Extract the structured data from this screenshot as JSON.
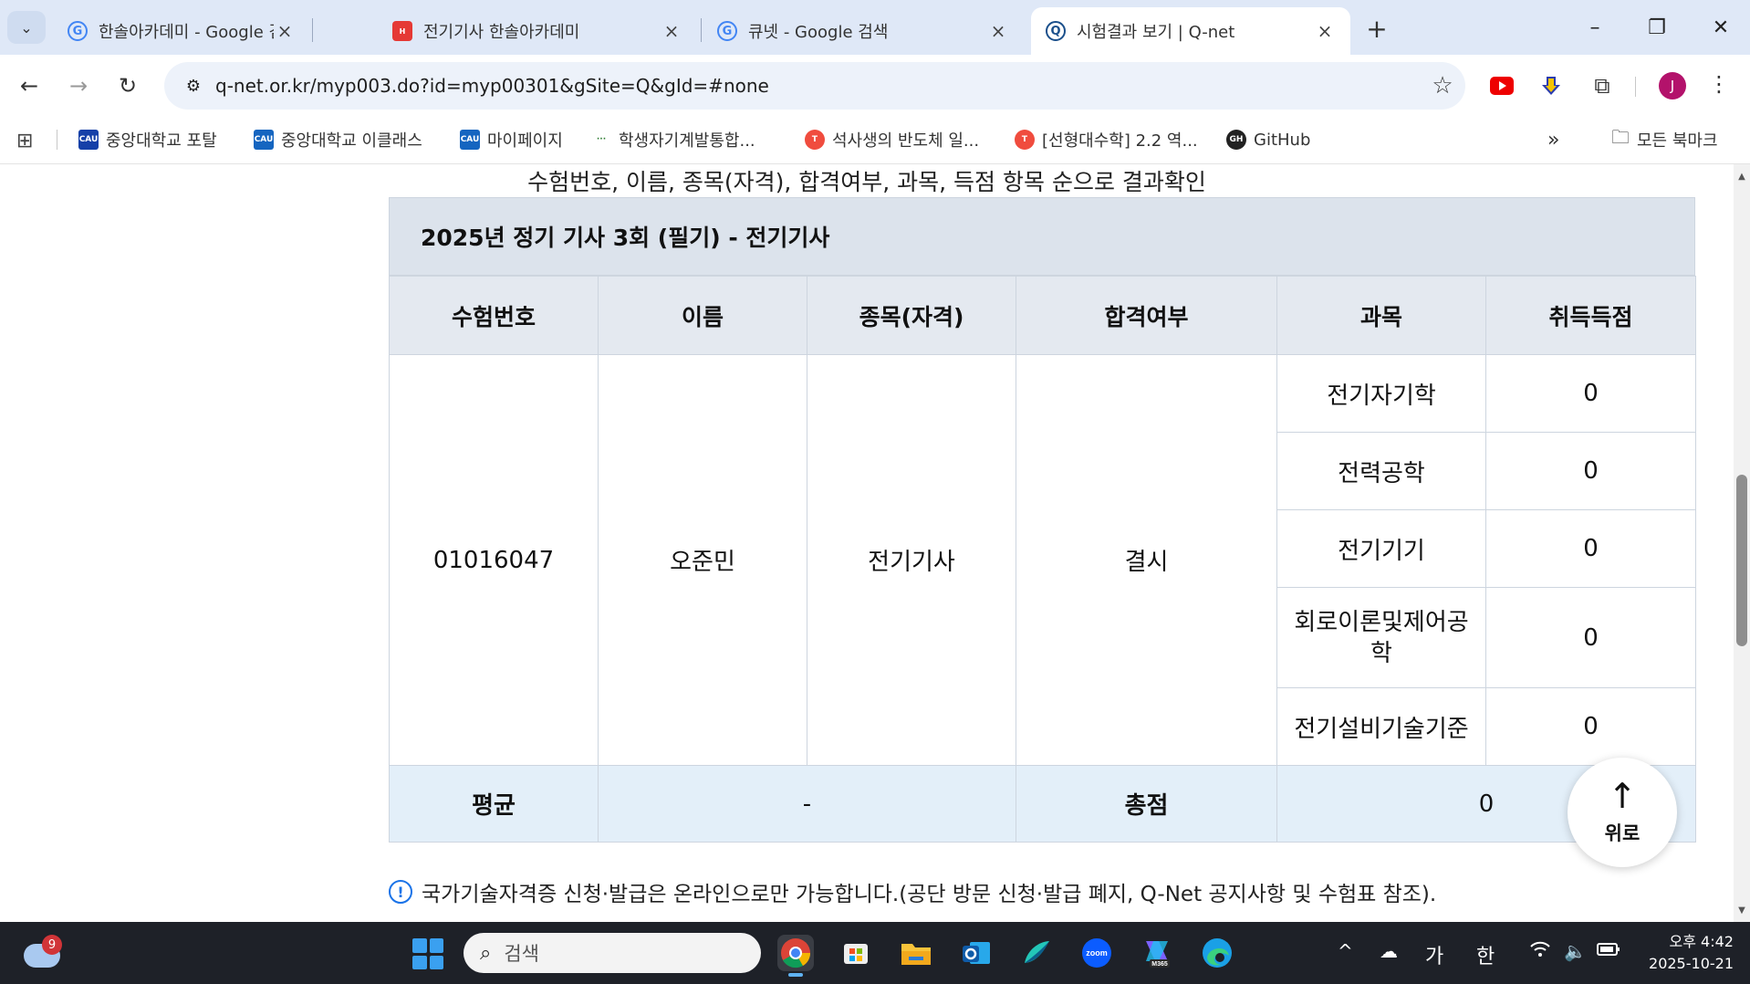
{
  "tabs": [
    {
      "title": "한솔아카데미 - Google 검색",
      "favicon": "google-icon"
    },
    {
      "title": "전기기사 한솔아카데미",
      "favicon": "hansol-icon"
    },
    {
      "title": "큐넷 - Google 검색",
      "favicon": "google-icon"
    },
    {
      "title": "시험결과 보기 | Q-net",
      "favicon": "qnet-icon",
      "active": true
    }
  ],
  "address_bar": {
    "url": "q-net.or.kr/myp003.do?id=myp00301&gSite=Q&gId=#none"
  },
  "profile_initial": "J",
  "bookmarks": [
    {
      "label": "중앙대학교 포탈",
      "icon_text": "CAU"
    },
    {
      "label": "중앙대학교 이클래스",
      "icon_text": "CAU"
    },
    {
      "label": "마이페이지",
      "icon_text": "CAU"
    },
    {
      "label": "학생자기계발통합...",
      "icon_text": "···"
    },
    {
      "label": "석사생의 반도체 일...",
      "icon_text": "T"
    },
    {
      "label": "[선형대수학] 2.2 역...",
      "icon_text": "T"
    },
    {
      "label": "GitHub",
      "icon_text": "GH"
    }
  ],
  "bookmarks_overflow": "»",
  "all_bookmarks": "모든 북마크",
  "page": {
    "heading": "수험번호, 이름, 종목(자격), 합격여부, 과목, 득점 항목 순으로 결과확인",
    "box_title": "2025년 정기 기사 3회 (필기) - 전기기사",
    "columns": [
      "수험번호",
      "이름",
      "종목(자격)",
      "합격여부",
      "과목",
      "취득득점"
    ],
    "exam_number": "01016047",
    "name": "오준민",
    "qualification": "전기기사",
    "pass_status": "결시",
    "subjects": [
      {
        "subject": "전기자기학",
        "score": "0"
      },
      {
        "subject": "전력공학",
        "score": "0"
      },
      {
        "subject": "전기기기",
        "score": "0"
      },
      {
        "subject": "회로이론및제어공학",
        "score": "0"
      },
      {
        "subject": "전기설비기술기준",
        "score": "0"
      }
    ],
    "footer": {
      "average_label": "평균",
      "average_value": "-",
      "total_label": "총점",
      "total_value": "0"
    },
    "notice": "국가기술자격증 신청·발급은 온라인으로만 가능합니다.(공단 방문 신청·발급 폐지, Q-Net 공지사항 및 수험표 참조).",
    "top_button": "위로"
  },
  "taskbar": {
    "weather_badge": "9",
    "search_placeholder": "검색",
    "ime_1": "가",
    "ime_2": "한",
    "time": "오후 4:42",
    "date": "2025-10-21"
  }
}
